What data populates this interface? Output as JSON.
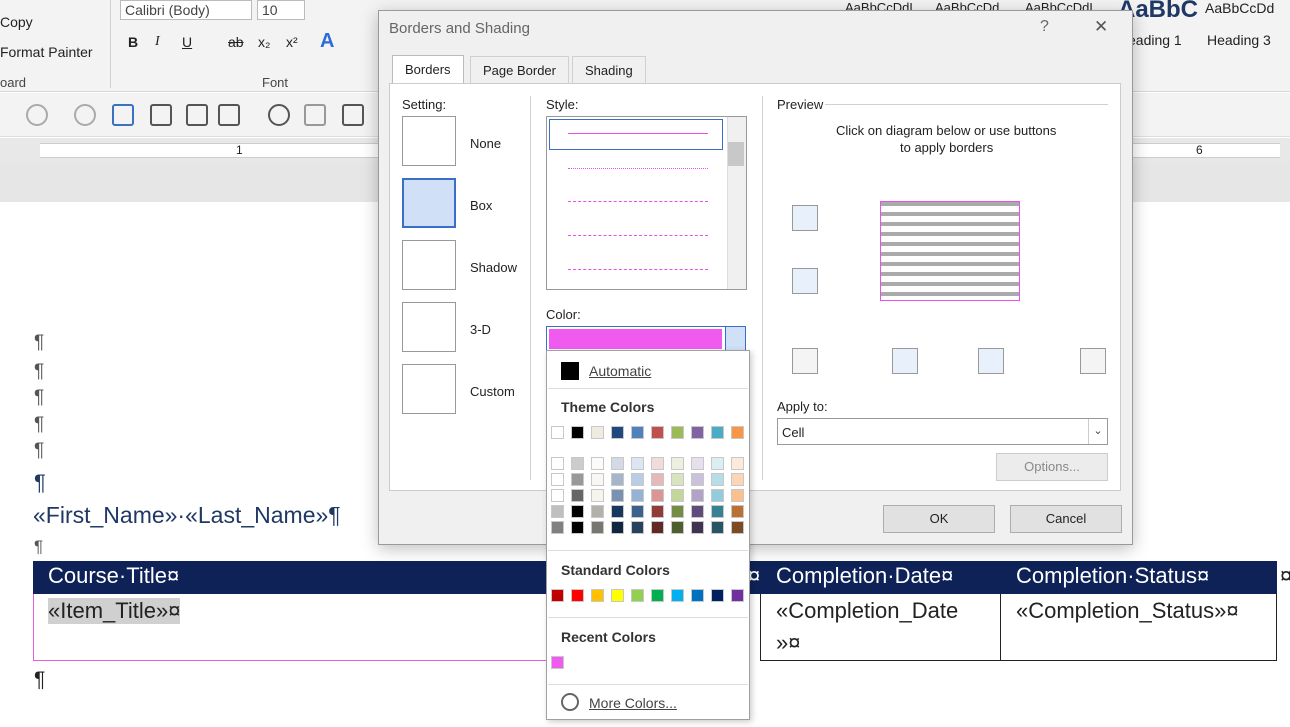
{
  "ribbon": {
    "copy": "Copy",
    "format_painter": "Format Painter",
    "clipboard_group": "oard",
    "font_group": "Font",
    "font_name": "Calibri (Body)",
    "font_size": "10",
    "styles": [
      "AaBbCcDdI",
      "AaBbCcDd",
      "AaBbCcDdI",
      "AaBbC",
      "AaBbCcDd"
    ],
    "heading1": "eading 1",
    "heading3": "Heading 3"
  },
  "ruler": {
    "mark1": "1",
    "mark6": "6"
  },
  "document": {
    "pilcrow": "¶",
    "name_line": "«First_Name»·«Last_Name»¶",
    "table": {
      "headers": [
        "Course·Title¤",
        "¤",
        "Completion·Date¤",
        "Completion·Status¤",
        "¤"
      ],
      "row": [
        "«Item_Title»¤",
        "«Completion_Date",
        "»¤",
        "«Completion_Status»¤"
      ]
    }
  },
  "dialog": {
    "title": "Borders and Shading",
    "help": "?",
    "close": "✕",
    "tabs": [
      "Borders",
      "Page Border",
      "Shading"
    ],
    "setting_label": "Setting:",
    "settings": [
      "None",
      "Box",
      "Shadow",
      "3-D",
      "Custom"
    ],
    "style_label": "Style:",
    "color_label": "Color:",
    "color_value": "#ef5bef",
    "preview_label": "Preview",
    "preview_hint_1": "Click on diagram below or use buttons",
    "preview_hint_2": "to apply borders",
    "apply_label": "Apply to:",
    "apply_value": "Cell",
    "options": "Options...",
    "ok": "OK",
    "cancel": "Cancel"
  },
  "color_popup": {
    "automatic": "Automatic",
    "theme_colors": "Theme Colors",
    "standard_colors": "Standard Colors",
    "recent_colors": "Recent Colors",
    "more_colors": "More Colors...",
    "theme_row": [
      "#ffffff",
      "#000000",
      "#eeece1",
      "#1f497d",
      "#4f81bd",
      "#c0504d",
      "#9bbb59",
      "#8064a2",
      "#4bacc6",
      "#f79646"
    ],
    "standard": [
      "#c00000",
      "#ff0000",
      "#ffc000",
      "#ffff00",
      "#92d050",
      "#00b050",
      "#00b0f0",
      "#0070c0",
      "#002060",
      "#7030a0"
    ],
    "recent": [
      "#ef5bef"
    ]
  }
}
